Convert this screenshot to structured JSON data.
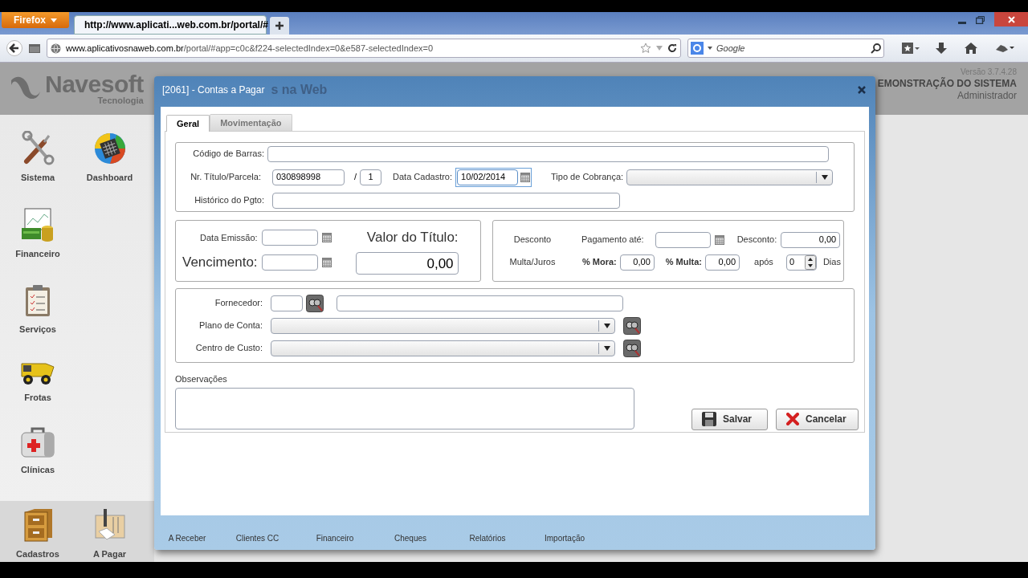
{
  "browser": {
    "menu_button": "Firefox",
    "tab_title": "http://www.aplicati...web.com.br/portal/#",
    "url_host": "www.aplicativosnaweb.com.br",
    "url_path": "/portal/#app=c0c&f224-selectedIndex=0&e587-selectedIndex=0",
    "search_placeholder": "Google"
  },
  "app": {
    "logo_name": "Navesoft",
    "logo_sub": "Tecnologia",
    "header_title_visible": "s na Web",
    "version": "Versão 3.7.4.28",
    "banner": "EMONSTRAÇÃO DO SISTEMA",
    "user": "Administrador",
    "sidebar": [
      {
        "label": "Sistema",
        "kind": "tools"
      },
      {
        "label": "Dashboard",
        "kind": "globe"
      },
      {
        "label": "Financeiro",
        "kind": "money"
      },
      {
        "label": "Serviços",
        "kind": "clipboard"
      },
      {
        "label": "Frotas",
        "kind": "truck"
      },
      {
        "label": "Clínicas",
        "kind": "medkit"
      }
    ],
    "sidebar_bottom": [
      {
        "label": "Cadastros",
        "kind": "cabinet"
      },
      {
        "label": "A Pagar",
        "kind": "paper"
      }
    ],
    "bottom_bar": [
      "A Receber",
      "Clientes CC",
      "Financeiro",
      "Cheques",
      "Relatórios",
      "Importação"
    ]
  },
  "modal": {
    "title": "[2061] - Contas a Pagar",
    "tabs": [
      {
        "label": "Geral",
        "selected": true
      },
      {
        "label": "Movimentação",
        "selected": false
      }
    ],
    "codigo_barras": {
      "label": "Código de Barras:"
    },
    "titulo": {
      "label": "Nr. Título/Parcela:",
      "value": "030898998",
      "separator": "/",
      "parcela": "1"
    },
    "data_cadastro": {
      "label": "Data Cadastro:",
      "value": "10/02/2014",
      "focused": true
    },
    "tipo_cobranca": {
      "label": "Tipo de Cobrança:"
    },
    "historico": {
      "label": "Histórico do Pgto:"
    },
    "data_emissao": {
      "label": "Data Emissão:"
    },
    "vencimento": {
      "label": "Vencimento:"
    },
    "valor_titulo": {
      "label": "Valor do Título:",
      "value": "0,00"
    },
    "desconto": {
      "section": "Desconto",
      "pagamento_label": "Pagamento até:",
      "label": "Desconto:",
      "value": "0,00"
    },
    "multa": {
      "section": "Multa/Juros",
      "mora_label": "% Mora:",
      "mora_value": "0,00",
      "multa_label": "% Multa:",
      "multa_value": "0,00",
      "apos_label": "após",
      "dias_value": "0",
      "dias_label": "Dias"
    },
    "fornecedor": {
      "label": "Fornecedor:"
    },
    "plano_conta": {
      "label": "Plano de Conta:"
    },
    "centro_custo": {
      "label": "Centro de Custo:"
    },
    "observacoes": {
      "label": "Observações"
    },
    "buttons": [
      {
        "label": "Salvar",
        "kind": "save"
      },
      {
        "label": "Cancelar",
        "kind": "cancel"
      }
    ]
  }
}
